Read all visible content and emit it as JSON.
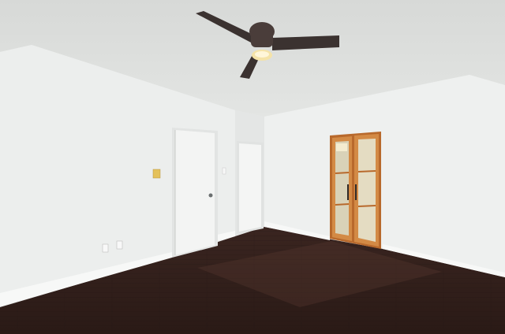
{
  "scene": {
    "description_label": "",
    "colors": {
      "ceiling": "#dfe1df",
      "wall_left": "#eceeed",
      "wall_back": "#e6e8e7",
      "wall_right": "#eef0ef",
      "baseboard": "#f7f8f7",
      "floor_dark": "#2e1f1b",
      "floor_mid": "#4a2f28",
      "door_white": "#f3f4f3",
      "door_wood": "#c77a35",
      "fan_blade": "#3b3230",
      "fan_light": "#f5e3a8",
      "switch_plate": "#e4c15a"
    },
    "icons": [
      "ceiling-fan-icon",
      "door-knob-icon",
      "wall-outlet-icon",
      "light-switch-icon"
    ]
  }
}
